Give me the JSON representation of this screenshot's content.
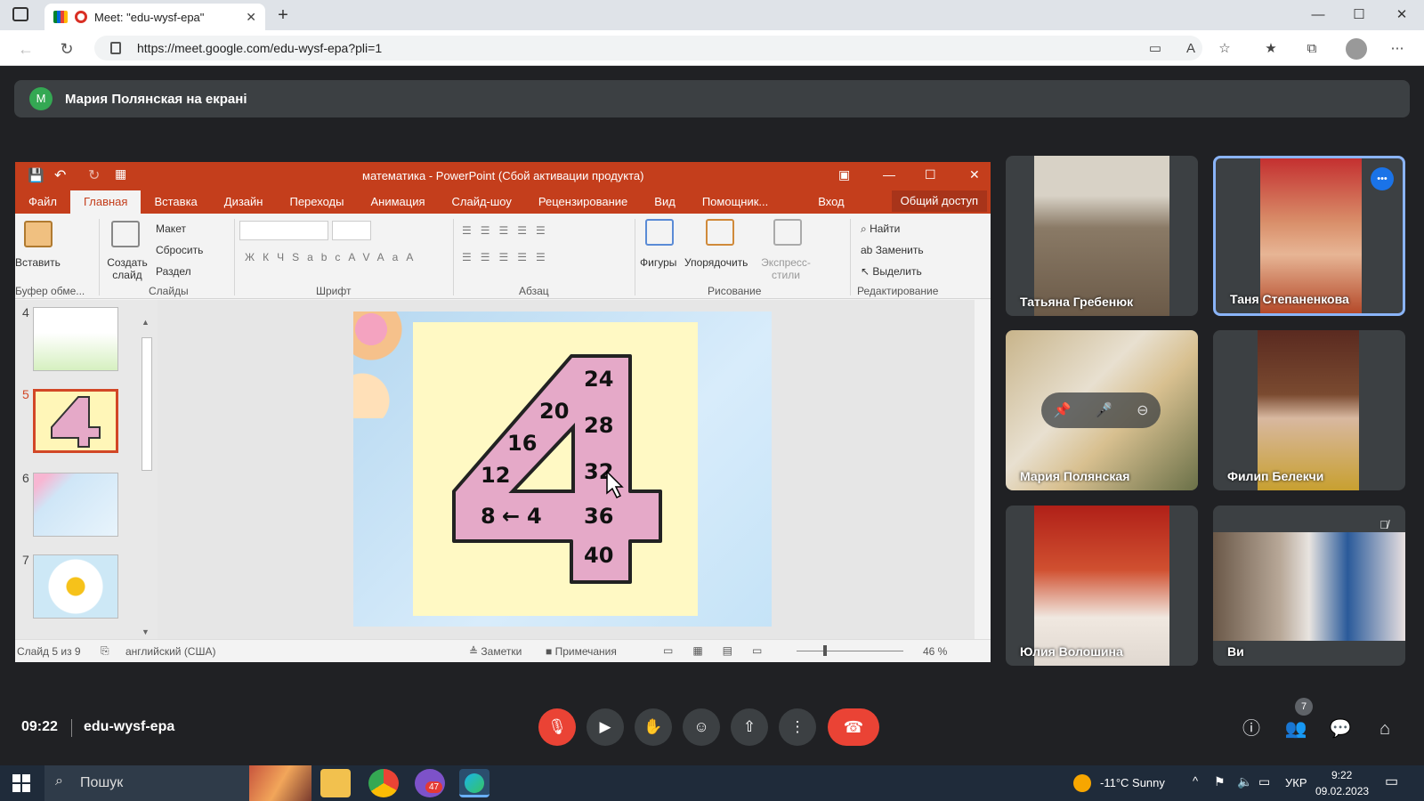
{
  "browser": {
    "tab_title": "Meet: \"edu-wysf-epa\"",
    "url": "https://meet.google.com/edu-wysf-epa?pli=1",
    "new_tab": "+",
    "close": "✕",
    "minimize": "—",
    "maximize": "☐"
  },
  "banner": {
    "avatar_letter": "M",
    "text": "Мария Полянская на екрані"
  },
  "ppt": {
    "title": "математика - PowerPoint (Сбой активации продукта)",
    "menu": [
      "Файл",
      "Главная",
      "Вставка",
      "Дизайн",
      "Переходы",
      "Анимация",
      "Слайд-шоу",
      "Рецензирование",
      "Вид",
      "Помощник..."
    ],
    "signin": "Вход",
    "share": "Общий доступ",
    "ribbon": {
      "paste": "Вставить",
      "clipboard": "Буфер обме...",
      "create_slide": "Создать слайд",
      "layout": "Макет",
      "reset": "Сбросить",
      "section": "Раздел",
      "slides_group": "Слайды",
      "font_group": "Шрифт",
      "paragraph_group": "Абзац",
      "shapes": "Фигуры",
      "arrange": "Упорядочить",
      "quick_styles": "Экспресс-стили",
      "drawing_group": "Рисование",
      "find": "Найти",
      "replace": "Заменить",
      "select": "Выделить",
      "editing_group": "Редактирование"
    },
    "thumb_numbers": [
      "4",
      "5",
      "6",
      "7"
    ],
    "slide_numbers": [
      "24",
      "20",
      "28",
      "16",
      "12",
      "32",
      "8",
      "←",
      "4",
      "36",
      "40"
    ],
    "status": {
      "slide": "Слайд 5 из 9",
      "language": "английский (США)",
      "notes": "Заметки",
      "comments": "Примечания",
      "zoom": "46 %"
    }
  },
  "participants": [
    {
      "name": "Татьяна Гребенюк"
    },
    {
      "name": "Таня Степаненкова"
    },
    {
      "name": "Мария Полянская"
    },
    {
      "name": "Филип Белекчи"
    },
    {
      "name": "Юлия Волошина"
    },
    {
      "name": "Ви"
    }
  ],
  "meeting": {
    "time": "09:22",
    "code": "edu-wysf-epa",
    "participant_count": "7"
  },
  "taskbar": {
    "search": "Пошук",
    "weather": "-11°C  Sunny",
    "lang": "УКР",
    "time": "9:22",
    "date": "09.02.2023",
    "badge": "47"
  }
}
